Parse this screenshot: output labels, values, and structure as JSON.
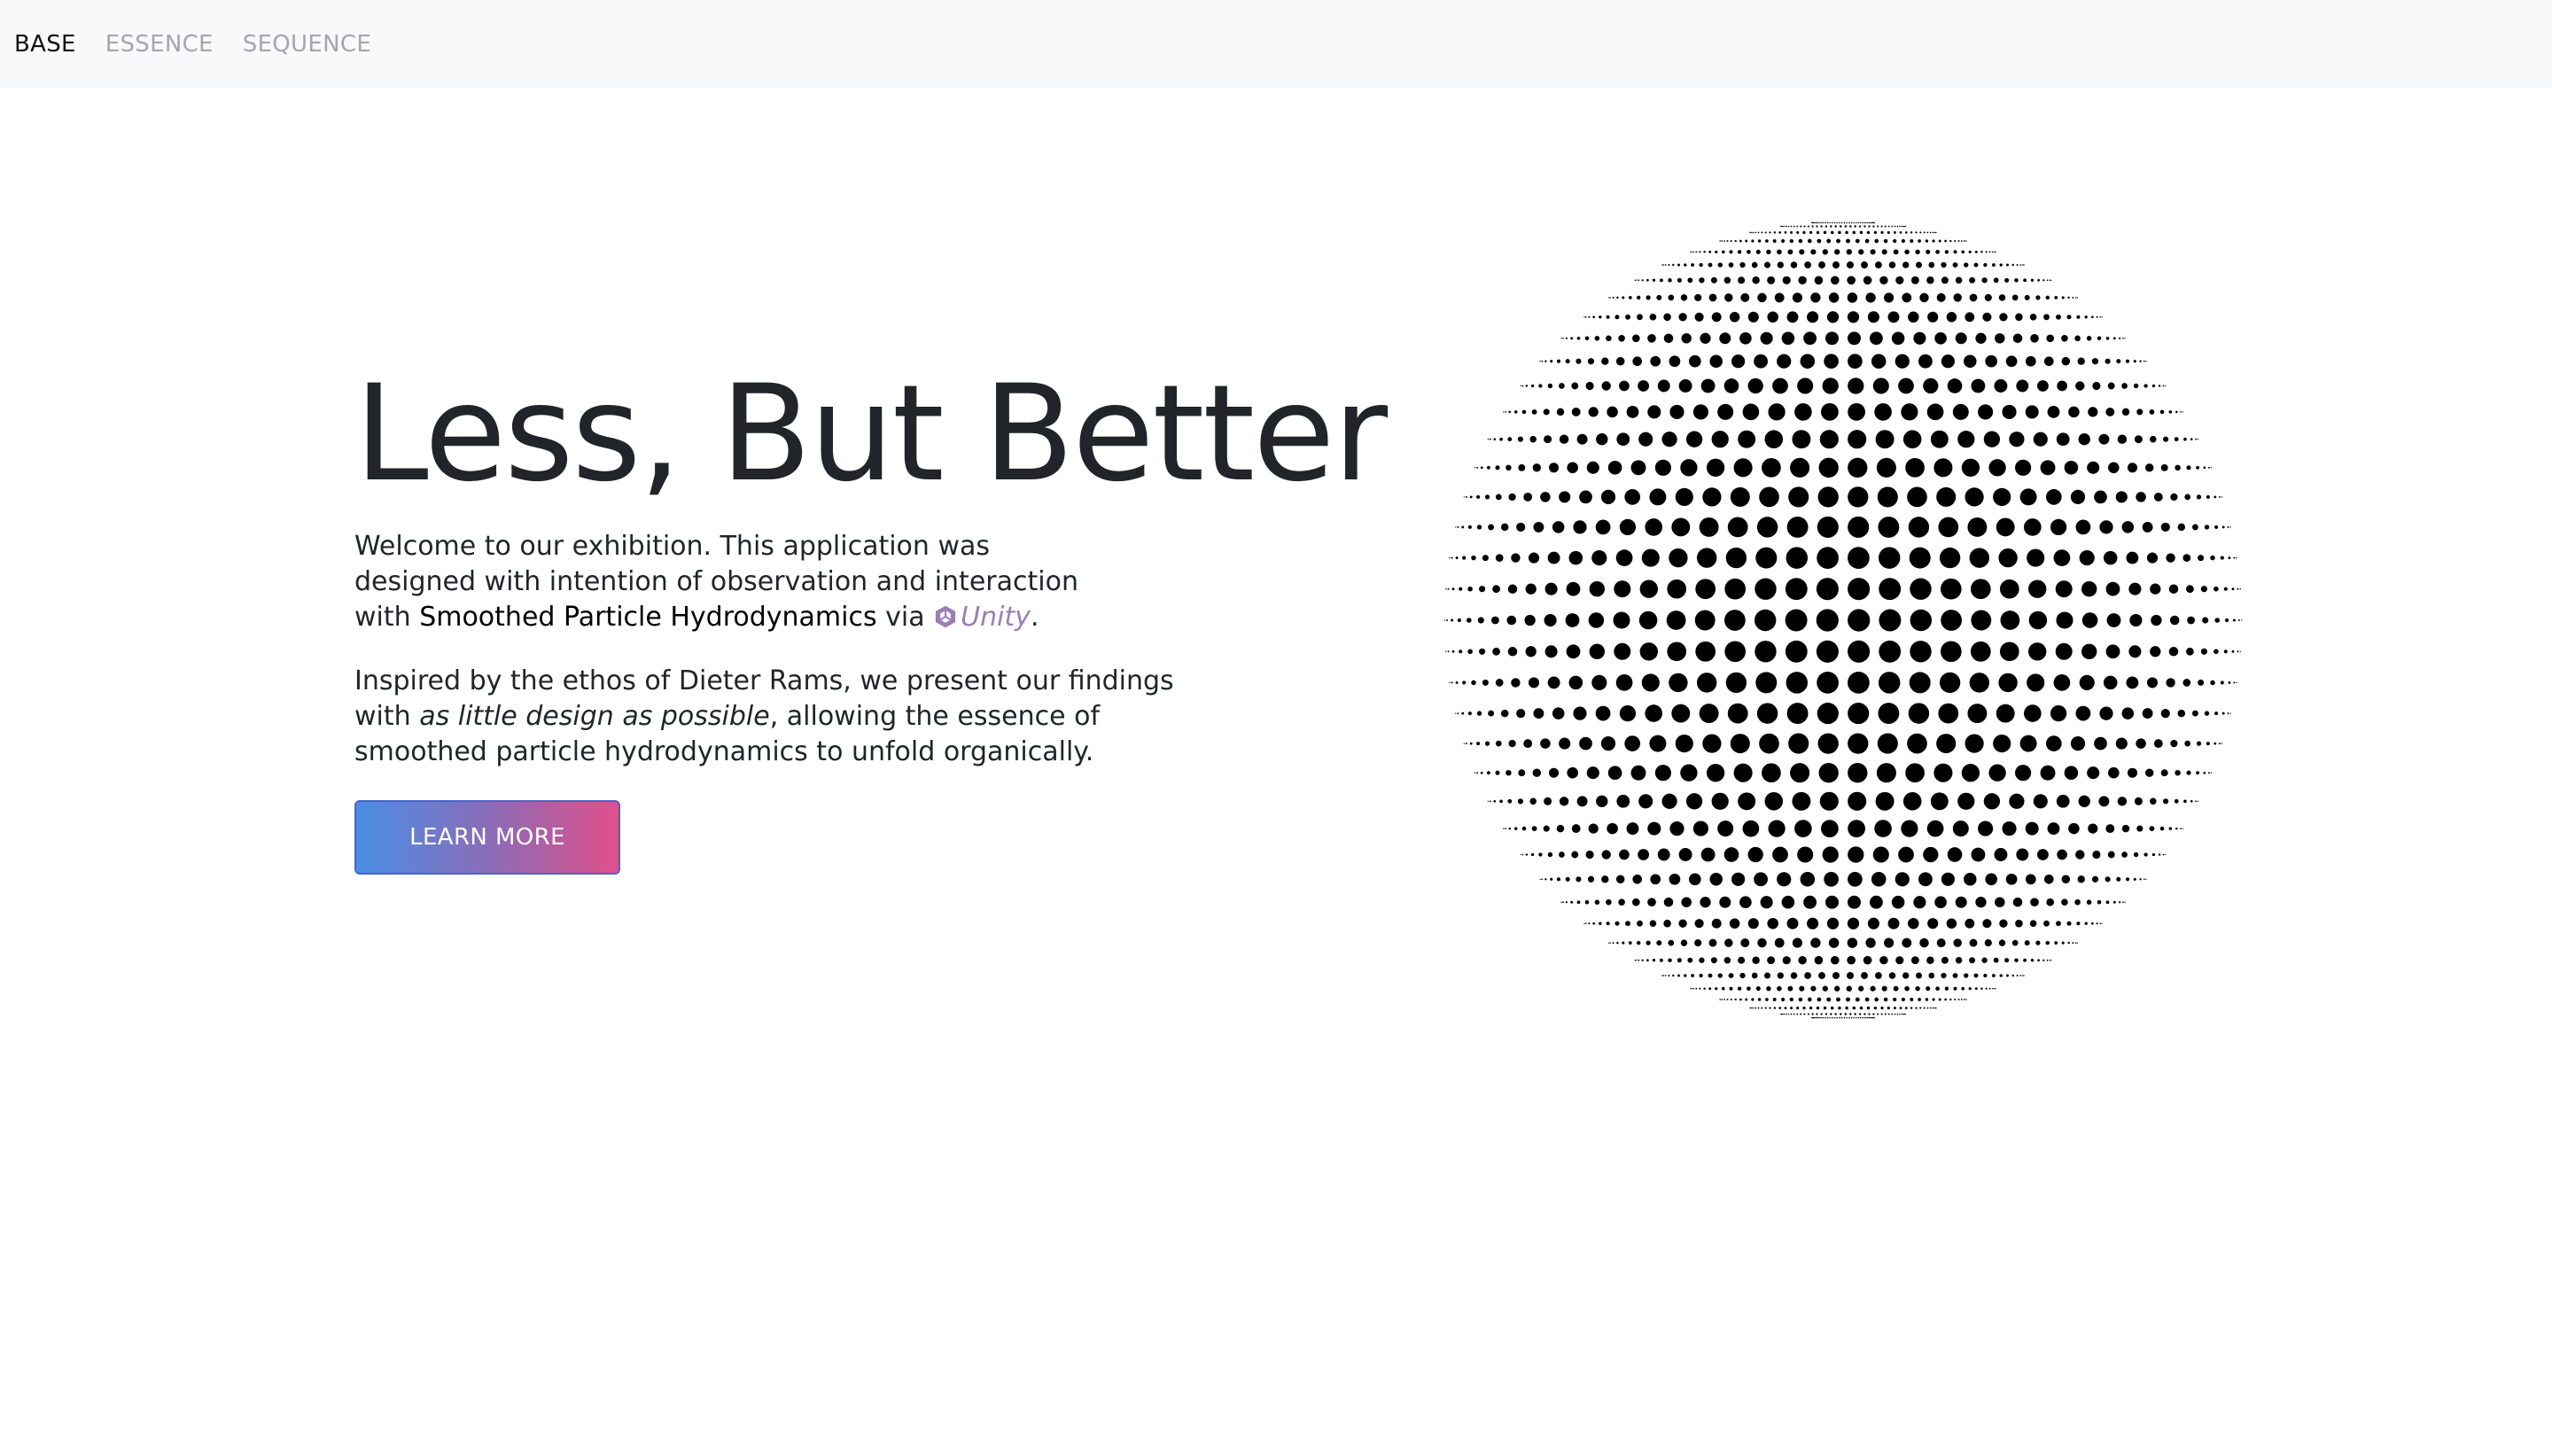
{
  "nav": {
    "items": [
      {
        "label": "BASE",
        "active": true
      },
      {
        "label": "ESSENCE",
        "active": false
      },
      {
        "label": "SEQUENCE",
        "active": false
      }
    ]
  },
  "hero": {
    "title": "Less, But Better",
    "p1": {
      "before": "Welcome to our exhibition. This application was designed with intention of observation and interaction with ",
      "term": "Smoothed Particle Hydrodynamics",
      "via": " via ",
      "link_label": "Unity",
      "after": "."
    },
    "p2": {
      "before": "Inspired by the ethos of Dieter Rams, we present our findings with ",
      "emphasis": "as little design as possible",
      "after": ", allowing the essence of smoothed particle hydrodynamics to unfold organically."
    },
    "cta_label": "LEARN MORE"
  },
  "icons": {
    "unity_logo": "unity-icon",
    "visual": "halftone-sphere"
  },
  "colors": {
    "navbar_bg": "#f8f9fa",
    "nav_active": "#111111",
    "nav_inactive": "#a4a7aa",
    "text": "#212529",
    "link": "#9b7eb3",
    "cta_gradient_start": "#4a8ee4",
    "cta_gradient_end": "#e0508a",
    "dots": "#000000"
  }
}
